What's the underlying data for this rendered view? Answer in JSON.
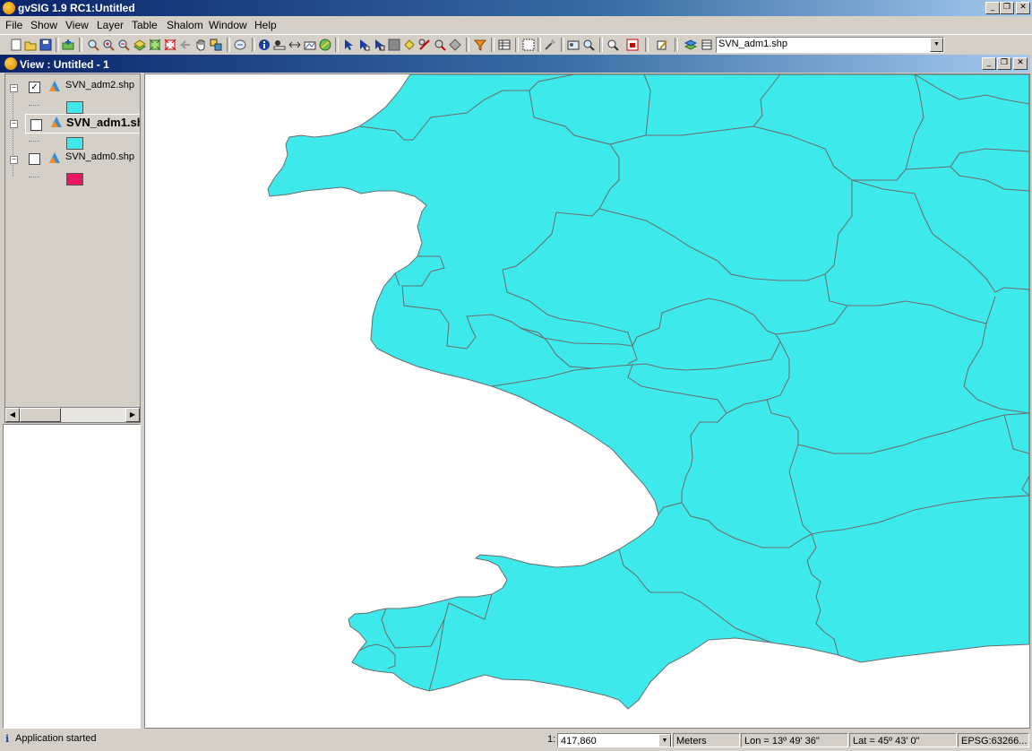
{
  "app": {
    "title": "gvSIG 1.9 RC1:Untitled"
  },
  "menu": [
    "File",
    "Show",
    "View",
    "Layer",
    "Table",
    "Shalom",
    "Window",
    "Help"
  ],
  "toolbar": {
    "active_layer": "SVN_adm1.shp"
  },
  "view": {
    "title": "View : Untitled - 1",
    "layers": [
      {
        "name": "SVN_adm2.shp",
        "checked": true,
        "active": false,
        "color": "#40e8e8"
      },
      {
        "name": "SVN_adm1.sh",
        "checked": false,
        "active": true,
        "color": "#40e8e8"
      },
      {
        "name": "SVN_adm0.shp",
        "checked": false,
        "active": false,
        "color": "#f01464"
      }
    ]
  },
  "map": {
    "fill_color": "#3de9ea",
    "stroke_color": "#6b6b6b"
  },
  "status": {
    "message": "Application started",
    "scale_prefix": "1:",
    "scale_value": "417,860",
    "units": "Meters",
    "lon": "Lon = 13º 49' 36\"",
    "lat": "Lat = 45º 43' 0\"",
    "epsg": "EPSG:63266..."
  }
}
